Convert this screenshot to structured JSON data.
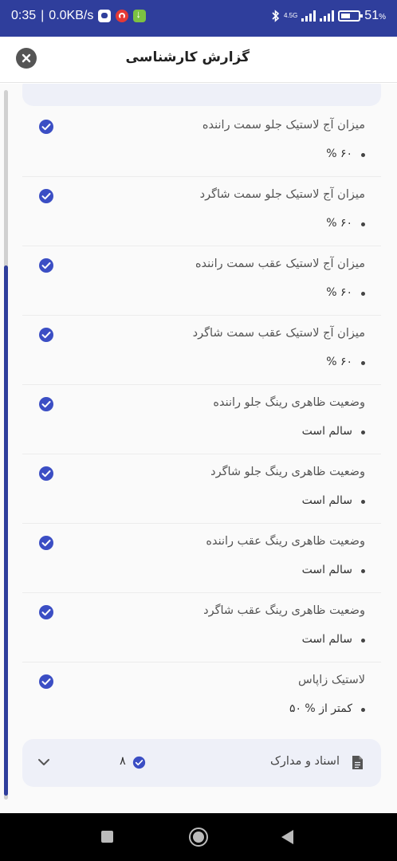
{
  "status_bar": {
    "time": "0:35",
    "speed": "0.0KB/s",
    "network": "4.5G",
    "battery": "51"
  },
  "header": {
    "title": "گزارش کارشناسی"
  },
  "items": [
    {
      "title": "میزان آج لاستیک جلو سمت راننده",
      "value": "۶۰ %"
    },
    {
      "title": "میزان آج لاستیک جلو سمت شاگرد",
      "value": "۶۰ %"
    },
    {
      "title": "میزان آج لاستیک عقب سمت راننده",
      "value": "۶۰ %"
    },
    {
      "title": "میزان آج لاستیک عقب سمت شاگرد",
      "value": "۶۰ %"
    },
    {
      "title": "وضعیت ظاهری رینگ جلو راننده",
      "value": "سالم است"
    },
    {
      "title": "وضعیت ظاهری رینگ جلو شاگرد",
      "value": "سالم است"
    },
    {
      "title": "وضعیت ظاهری رینگ عقب راننده",
      "value": "سالم است"
    },
    {
      "title": "وضعیت ظاهری رینگ عقب شاگرد",
      "value": "سالم است"
    },
    {
      "title": "لاستیک زاپاس",
      "value": "کمتر از % ۵۰"
    }
  ],
  "docs": {
    "label": "اسناد و مدارک",
    "count": "۸"
  },
  "colors": {
    "primary": "#2f3e9c",
    "check": "#3b4ec4"
  }
}
